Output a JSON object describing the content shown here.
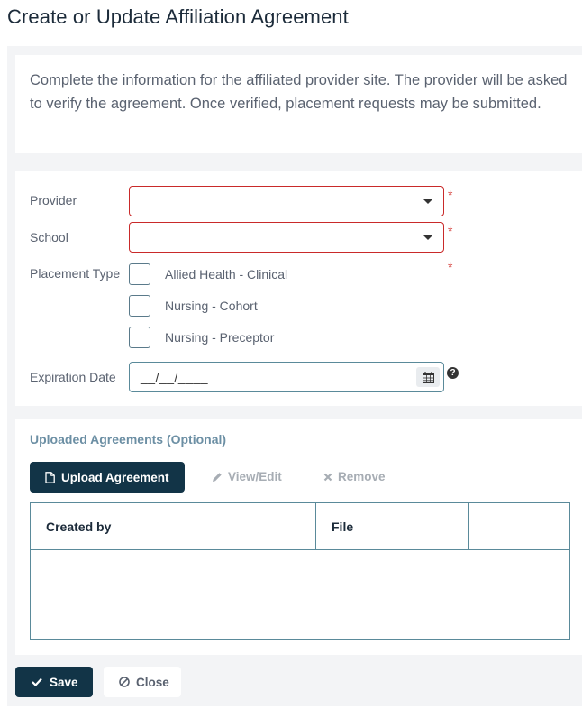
{
  "page": {
    "title": "Create or Update Affiliation Agreement"
  },
  "intro": {
    "text": "Complete the information for the affiliated provider site. The provider will be asked to verify the agreement. Once verified, placement requests may be submitted."
  },
  "form": {
    "provider": {
      "label": "Provider",
      "value": "",
      "required_mark": "*"
    },
    "school": {
      "label": "School",
      "value": "",
      "required_mark": "*"
    },
    "placement_type": {
      "label": "Placement Type",
      "required_mark": "*",
      "options": [
        {
          "label": "Allied Health - Clinical",
          "checked": false
        },
        {
          "label": "Nursing - Cohort",
          "checked": false
        },
        {
          "label": "Nursing - Preceptor",
          "checked": false
        }
      ]
    },
    "expiration_date": {
      "label": "Expiration Date",
      "value": "__/__/____"
    }
  },
  "uploads": {
    "title": "Uploaded Agreements (Optional)",
    "upload_label": "Upload Agreement",
    "view_edit_label": "View/Edit",
    "remove_label": "Remove",
    "table": {
      "columns": [
        "Created by",
        "File",
        ""
      ],
      "rows": []
    }
  },
  "footer": {
    "save_label": "Save",
    "close_label": "Close"
  },
  "colors": {
    "primary": "#123447",
    "error_border": "#c92a2a",
    "required_star": "#d9534f",
    "section_title": "#6c8fa4",
    "panel_bg": "#f3f4f6"
  }
}
